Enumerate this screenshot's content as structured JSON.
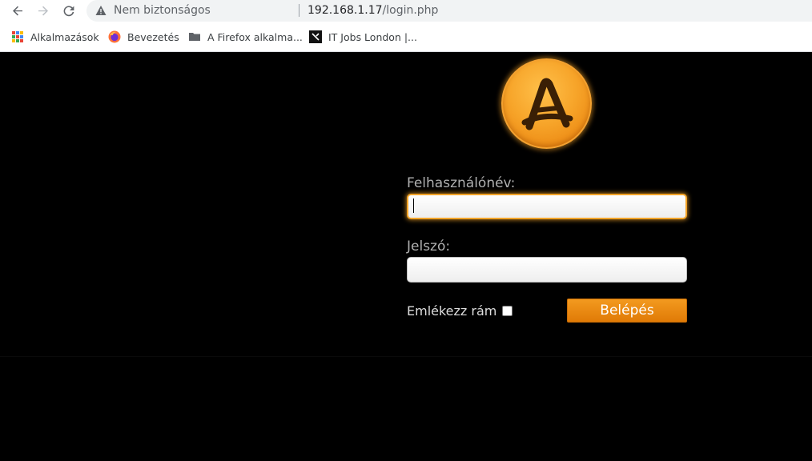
{
  "browser": {
    "nav": {
      "back": "back-icon",
      "forward": "forward-icon",
      "reload": "reload-icon"
    },
    "omnibox": {
      "security_icon": "warning-icon",
      "security_text": "Nem biztonságos",
      "url_host": "192.168.1.17",
      "url_path": "/login.php"
    },
    "bookmarks": [
      {
        "label": "Alkalmazások",
        "icon": "apps-grid-icon"
      },
      {
        "label": "Bevezetés",
        "icon": "firefox-icon"
      },
      {
        "label": "A Firefox alkalma...",
        "icon": "folder-icon"
      },
      {
        "label": "IT Jobs London |...",
        "icon": "site-favicon-icon"
      }
    ]
  },
  "login": {
    "logo_letter": "A",
    "username_label": "Felhasználónév:",
    "username_value": "",
    "password_label": "Jelszó:",
    "password_value": "",
    "remember_label": "Emlékezz rám",
    "remember_checked": false,
    "submit_label": "Belépés"
  },
  "colors": {
    "accent": "#f2a327",
    "button": "#e98a12",
    "page_bg": "#000000",
    "label": "#b0b0b0"
  }
}
